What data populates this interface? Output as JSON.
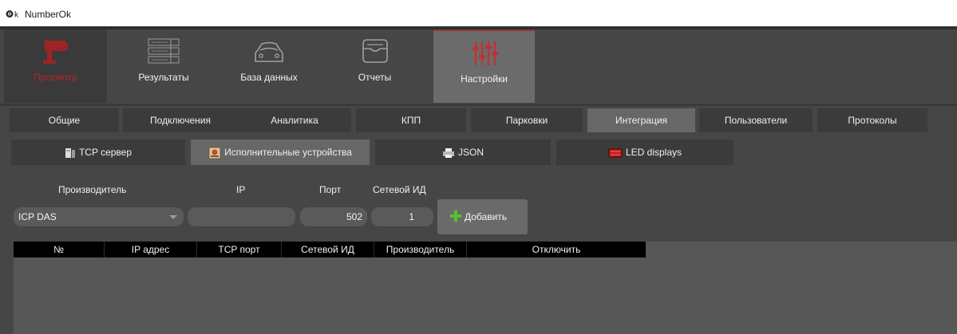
{
  "window": {
    "title": "NumberOk"
  },
  "toolbar": {
    "view": "Просмотр",
    "results": "Результаты",
    "database": "База данных",
    "reports": "Отчеты",
    "settings": "Настройки"
  },
  "tabs": [
    {
      "label": "Общие",
      "active": false
    },
    {
      "label": "Подключения",
      "active": false
    },
    {
      "label": "Аналитика",
      "active": false
    },
    {
      "label": "КПП",
      "active": false
    },
    {
      "label": "Парковки",
      "active": false
    },
    {
      "label": "Интеграция",
      "active": true
    },
    {
      "label": "Пользователи",
      "active": false
    },
    {
      "label": "Протоколы",
      "active": false
    }
  ],
  "subtabs": [
    {
      "label": "TCP сервер",
      "active": false
    },
    {
      "label": "Исполнительные устройства",
      "active": true
    },
    {
      "label": "JSON",
      "active": false
    },
    {
      "label": "LED displays",
      "active": false
    }
  ],
  "form": {
    "labels": {
      "maker": "Производитель",
      "ip": "IP",
      "port": "Порт",
      "netid": "Сетевой ИД"
    },
    "maker_value": "ICP DAS",
    "ip_value": "",
    "port_value": "502",
    "netid_value": "1",
    "add_label": "Добавить"
  },
  "table": {
    "columns": [
      "№",
      "IP адрес",
      "TCP порт",
      "Сетевой ИД",
      "Производитель",
      "Отключить"
    ],
    "rows": []
  },
  "colors": {
    "background": "#464646",
    "panel": "#3b3b3b",
    "active": "#676767",
    "accent_red": "#b32727",
    "table_header": "#000000"
  }
}
